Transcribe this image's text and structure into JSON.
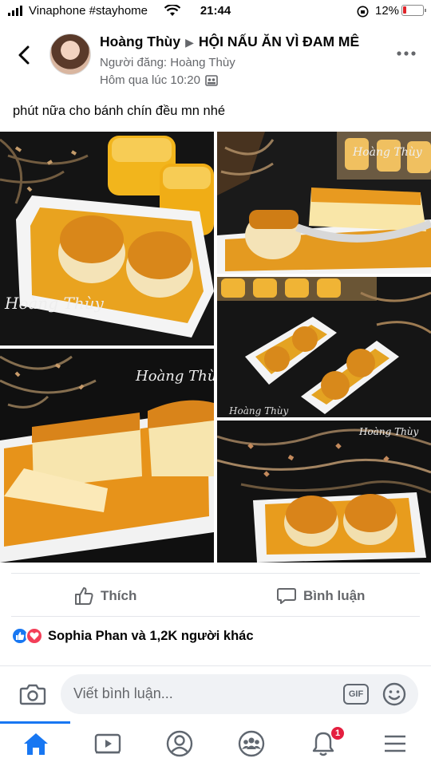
{
  "status_bar": {
    "carrier": "Vinaphone #stayhome",
    "time": "21:44",
    "battery_percent": "12%"
  },
  "header": {
    "author": "Hoàng Thùy",
    "separator_icon": "triangle-right-icon",
    "group": "HỘI NẤU ĂN VÌ ĐAM MÊ",
    "posted_by": "Người đăng: Hoàng Thùy",
    "timestamp": "Hôm qua lúc 10:20",
    "privacy_icon": "group-privacy-icon"
  },
  "post": {
    "caption": "phút nữa cho bánh chín đều mn nhé",
    "watermark": "Hoàng Thùy",
    "photos": [
      {
        "name": "photo-flan-tray-with-cups"
      },
      {
        "name": "photo-flan-on-spoon"
      },
      {
        "name": "photo-two-flan-trays"
      },
      {
        "name": "photo-flan-sliced"
      },
      {
        "name": "photo-flan-tray-flowers"
      }
    ]
  },
  "actions": {
    "like": "Thích",
    "comment": "Bình luận"
  },
  "reactions": {
    "summary": "Sophia Phan và 1,2K người khác",
    "colors": {
      "like": "#1877f2",
      "love": "#f33e58"
    }
  },
  "comment_bar": {
    "placeholder": "Viết bình luận...",
    "gif_label": "GIF"
  },
  "tab_bar": {
    "tabs": [
      "home-icon",
      "video-icon",
      "profile-icon",
      "groups-icon",
      "notifications-icon",
      "menu-icon"
    ],
    "notification_count": "1",
    "accent": "#1877f2"
  }
}
